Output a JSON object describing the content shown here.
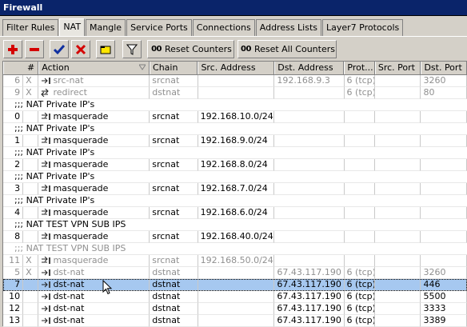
{
  "window": {
    "title": "Firewall"
  },
  "tabs": [
    {
      "label": "Filter Rules",
      "active": false
    },
    {
      "label": "NAT",
      "active": true
    },
    {
      "label": "Mangle",
      "active": false
    },
    {
      "label": "Service Ports",
      "active": false
    },
    {
      "label": "Connections",
      "active": false
    },
    {
      "label": "Address Lists",
      "active": false
    },
    {
      "label": "Layer7 Protocols",
      "active": false
    }
  ],
  "toolbar": {
    "add_icon": "plus-icon",
    "remove_icon": "minus-icon",
    "enable_icon": "checkmark-icon",
    "disable_icon": "x-icon",
    "comment_icon": "comment-icon",
    "filter_icon": "filter-icon",
    "reset_counters_label": "Reset Counters",
    "reset_all_counters_label": "Reset All Counters",
    "counter_prefix": "00"
  },
  "columns": [
    "#",
    "Action",
    "Chain",
    "Src. Address",
    "Dst. Address",
    "Prot...",
    "Src. Port",
    "Dst. Port"
  ],
  "rows": [
    {
      "kind": "rule",
      "num": "6",
      "flag": "X",
      "action": "src-nat",
      "chain": "srcnat",
      "src": "",
      "dst": "192.168.9.3",
      "proto": "6 (tcp)",
      "sport": "",
      "dport": "3260",
      "disabled": true
    },
    {
      "kind": "rule",
      "num": "9",
      "flag": "X",
      "action": "redirect",
      "chain": "dstnat",
      "src": "",
      "dst": "",
      "proto": "6 (tcp)",
      "sport": "",
      "dport": "80",
      "disabled": true
    },
    {
      "kind": "comment",
      "text": ";;; NAT Private IP's"
    },
    {
      "kind": "rule",
      "num": "0",
      "flag": "",
      "action": "masquerade",
      "chain": "srcnat",
      "src": "192.168.10.0/24",
      "dst": "",
      "proto": "",
      "sport": "",
      "dport": "",
      "disabled": false
    },
    {
      "kind": "comment",
      "text": ";;; NAT Private IP's"
    },
    {
      "kind": "rule",
      "num": "1",
      "flag": "",
      "action": "masquerade",
      "chain": "srcnat",
      "src": "192.168.9.0/24",
      "dst": "",
      "proto": "",
      "sport": "",
      "dport": "",
      "disabled": false
    },
    {
      "kind": "comment",
      "text": ";;; NAT Private IP's"
    },
    {
      "kind": "rule",
      "num": "2",
      "flag": "",
      "action": "masquerade",
      "chain": "srcnat",
      "src": "192.168.8.0/24",
      "dst": "",
      "proto": "",
      "sport": "",
      "dport": "",
      "disabled": false
    },
    {
      "kind": "comment",
      "text": ";;; NAT Private IP's"
    },
    {
      "kind": "rule",
      "num": "3",
      "flag": "",
      "action": "masquerade",
      "chain": "srcnat",
      "src": "192.168.7.0/24",
      "dst": "",
      "proto": "",
      "sport": "",
      "dport": "",
      "disabled": false
    },
    {
      "kind": "comment",
      "text": ";;; NAT Private IP's"
    },
    {
      "kind": "rule",
      "num": "4",
      "flag": "",
      "action": "masquerade",
      "chain": "srcnat",
      "src": "192.168.6.0/24",
      "dst": "",
      "proto": "",
      "sport": "",
      "dport": "",
      "disabled": false
    },
    {
      "kind": "comment",
      "text": ";;; NAT TEST VPN SUB IPS"
    },
    {
      "kind": "rule",
      "num": "8",
      "flag": "",
      "action": "masquerade",
      "chain": "srcnat",
      "src": "192.168.40.0/24",
      "dst": "",
      "proto": "",
      "sport": "",
      "dport": "",
      "disabled": false
    },
    {
      "kind": "comment",
      "text": ";;; NAT TEST VPN SUB IPS",
      "disabled": true
    },
    {
      "kind": "rule",
      "num": "11",
      "flag": "X",
      "action": "masquerade",
      "chain": "srcnat",
      "src": "192.168.50.0/24",
      "dst": "",
      "proto": "",
      "sport": "",
      "dport": "",
      "disabled": true
    },
    {
      "kind": "rule",
      "num": "5",
      "flag": "X",
      "action": "dst-nat",
      "chain": "dstnat",
      "src": "",
      "dst": "67.43.117.190",
      "proto": "6 (tcp)",
      "sport": "",
      "dport": "3260",
      "disabled": true
    },
    {
      "kind": "rule",
      "num": "7",
      "flag": "",
      "action": "dst-nat",
      "chain": "dstnat",
      "src": "",
      "dst": "67.43.117.190",
      "proto": "6 (tcp)",
      "sport": "",
      "dport": "446",
      "disabled": false,
      "selected": true
    },
    {
      "kind": "rule",
      "num": "10",
      "flag": "",
      "action": "dst-nat",
      "chain": "dstnat",
      "src": "",
      "dst": "67.43.117.190",
      "proto": "6 (tcp)",
      "sport": "",
      "dport": "5500",
      "disabled": false
    },
    {
      "kind": "rule",
      "num": "12",
      "flag": "",
      "action": "dst-nat",
      "chain": "dstnat",
      "src": "",
      "dst": "67.43.117.190",
      "proto": "6 (tcp)",
      "sport": "",
      "dport": "3333",
      "disabled": false
    },
    {
      "kind": "rule",
      "num": "13",
      "flag": "",
      "action": "dst-nat",
      "chain": "dstnat",
      "src": "",
      "dst": "67.43.117.190",
      "proto": "6 (tcp)",
      "sport": "",
      "dport": "3389",
      "disabled": false
    }
  ]
}
